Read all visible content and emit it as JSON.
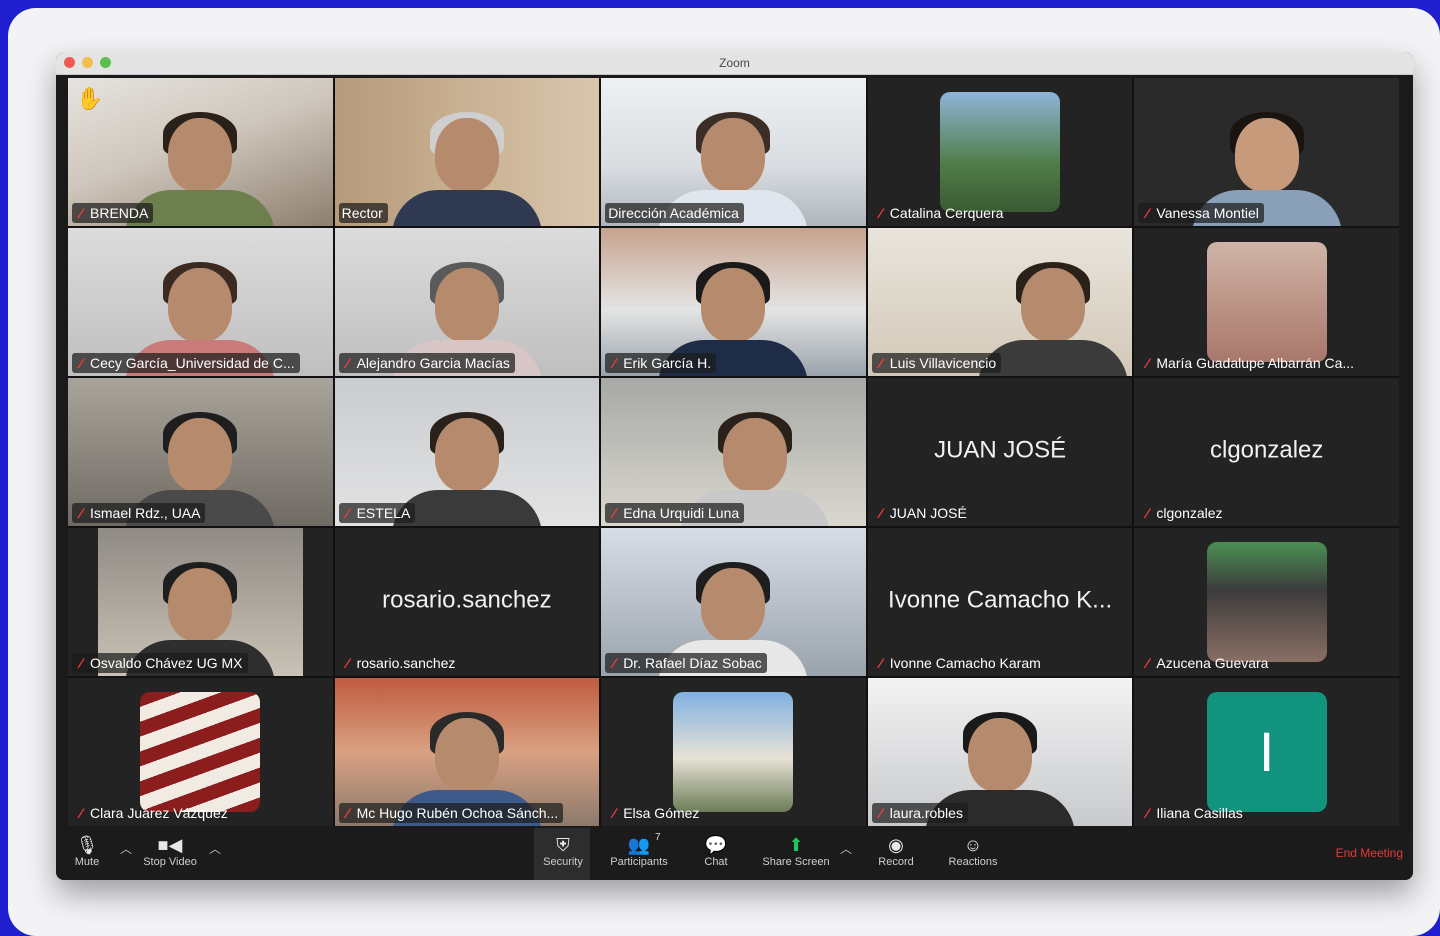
{
  "window": {
    "title": "Zoom"
  },
  "tiles": [
    {
      "name": "BRENDA",
      "muted": true,
      "raised_hand": true,
      "active": false
    },
    {
      "name": "Rector",
      "muted": false,
      "raised_hand": false,
      "active": true
    },
    {
      "name": "Dirección Académica",
      "muted": false,
      "raised_hand": false,
      "active": false
    },
    {
      "name": "Catalina Cerquera",
      "muted": true,
      "raised_hand": false,
      "active": false
    },
    {
      "name": "Vanessa Montiel",
      "muted": true,
      "raised_hand": false,
      "active": false
    },
    {
      "name": "Cecy García_Universidad de C...",
      "muted": true,
      "raised_hand": false,
      "active": false
    },
    {
      "name": "Alejandro Garcia Macías",
      "muted": true,
      "raised_hand": false,
      "active": false
    },
    {
      "name": "Erik García H.",
      "muted": true,
      "raised_hand": false,
      "active": false
    },
    {
      "name": "Luis Villavicencio",
      "muted": true,
      "raised_hand": false,
      "active": false
    },
    {
      "name": "María Guadalupe Albarrán Ca...",
      "muted": true,
      "raised_hand": false,
      "active": false
    },
    {
      "name": "Ismael Rdz., UAA",
      "muted": true,
      "raised_hand": false,
      "active": false
    },
    {
      "name": "ESTELA",
      "muted": true,
      "raised_hand": false,
      "active": false
    },
    {
      "name": "Edna Urquidi Luna",
      "muted": true,
      "raised_hand": false,
      "active": false
    },
    {
      "name": "JUAN JOSÉ",
      "display": "JUAN JOSÉ",
      "muted": true,
      "raised_hand": false,
      "active": false
    },
    {
      "name": "clgonzalez",
      "display": "clgonzalez",
      "muted": true,
      "raised_hand": false,
      "active": false
    },
    {
      "name": "Osvaldo Chávez UG MX",
      "muted": true,
      "raised_hand": false,
      "active": false
    },
    {
      "name": "rosario.sanchez",
      "display": "rosario.sanchez",
      "muted": true,
      "raised_hand": false,
      "active": false
    },
    {
      "name": "Dr. Rafael Díaz Sobac",
      "muted": true,
      "raised_hand": false,
      "active": false
    },
    {
      "name": "Ivonne Camacho Karam",
      "display": "Ivonne Camacho K...",
      "muted": true,
      "raised_hand": false,
      "active": false
    },
    {
      "name": "Azucena Guevara",
      "muted": true,
      "raised_hand": false,
      "active": false
    },
    {
      "name": "Clara Juárez Vázquez",
      "muted": true,
      "raised_hand": false,
      "active": false
    },
    {
      "name": "Mc Hugo Rubén Ochoa Sánch...",
      "muted": true,
      "raised_hand": false,
      "active": false
    },
    {
      "name": "Elsa Gómez",
      "muted": true,
      "raised_hand": false,
      "active": false
    },
    {
      "name": "laura.robles",
      "muted": true,
      "raised_hand": false,
      "active": false
    },
    {
      "name": "Iliana Casillas",
      "initial": "I",
      "muted": true,
      "raised_hand": false,
      "active": false
    }
  ],
  "toolbar": {
    "mute": "Mute",
    "stop_video": "Stop Video",
    "security": "Security",
    "participants": "Participants",
    "participants_count": "7",
    "chat": "Chat",
    "share_screen": "Share Screen",
    "record": "Record",
    "reactions": "Reactions",
    "end_meeting": "End Meeting"
  },
  "colors": {
    "active_speaker": "#22c55e",
    "muted_icon": "#ff3b3b",
    "end_meeting": "#e23b3b",
    "avatar_initial_bg": "#12937d",
    "page_bg": "#1f1fd0"
  }
}
